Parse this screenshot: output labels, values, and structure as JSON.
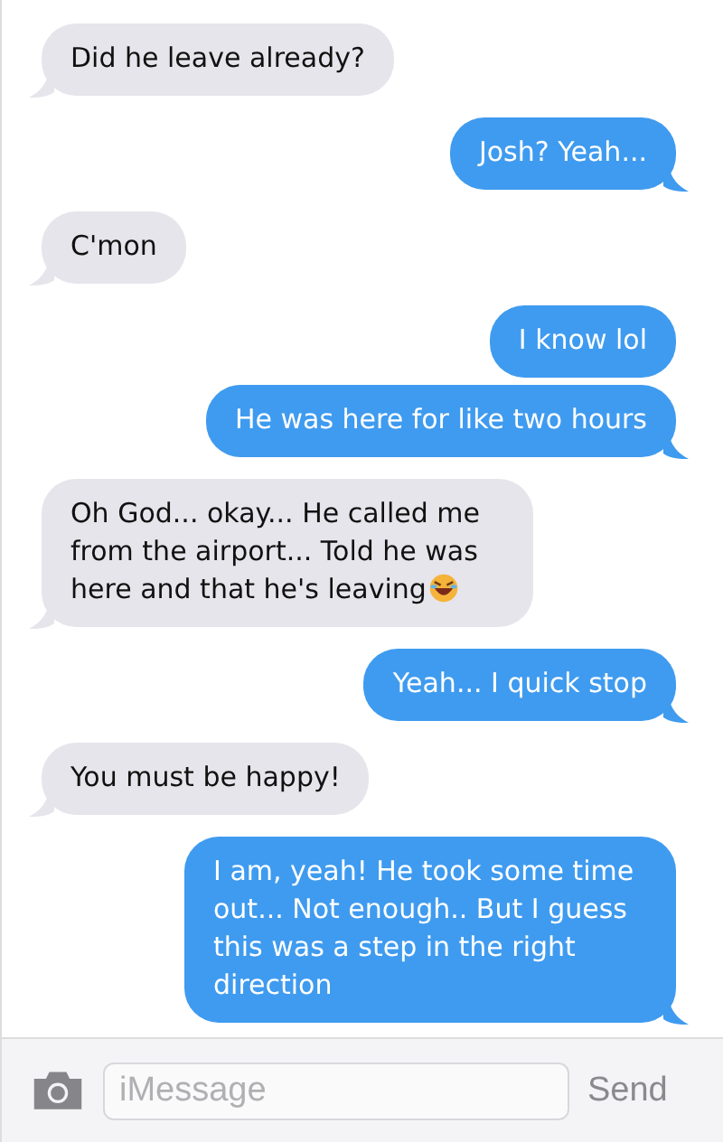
{
  "messages": [
    {
      "kind": "received",
      "text": "Did he leave already?",
      "tail": true
    },
    {
      "kind": "sent",
      "text": "Josh? Yeah...",
      "tail": true
    },
    {
      "kind": "received",
      "text": "C'mon",
      "tail": true
    },
    {
      "kind": "sent",
      "text": "I know lol",
      "tail": false
    },
    {
      "kind": "sent",
      "text": "He was here for like two hours",
      "tail": true
    },
    {
      "kind": "received",
      "text": "Oh God... okay... He called me from the airport... Told he was here and that he's leaving",
      "tail": true,
      "emoji": true
    },
    {
      "kind": "sent",
      "text": "Yeah... I quick stop",
      "tail": true
    },
    {
      "kind": "received",
      "text": "You must be happy!",
      "tail": true
    },
    {
      "kind": "sent",
      "text": "I am, yeah! He took some time out... Not enough.. But I guess this was a step in the right direction",
      "tail": true
    }
  ],
  "composer": {
    "placeholder": "iMessage",
    "send": "Send"
  }
}
